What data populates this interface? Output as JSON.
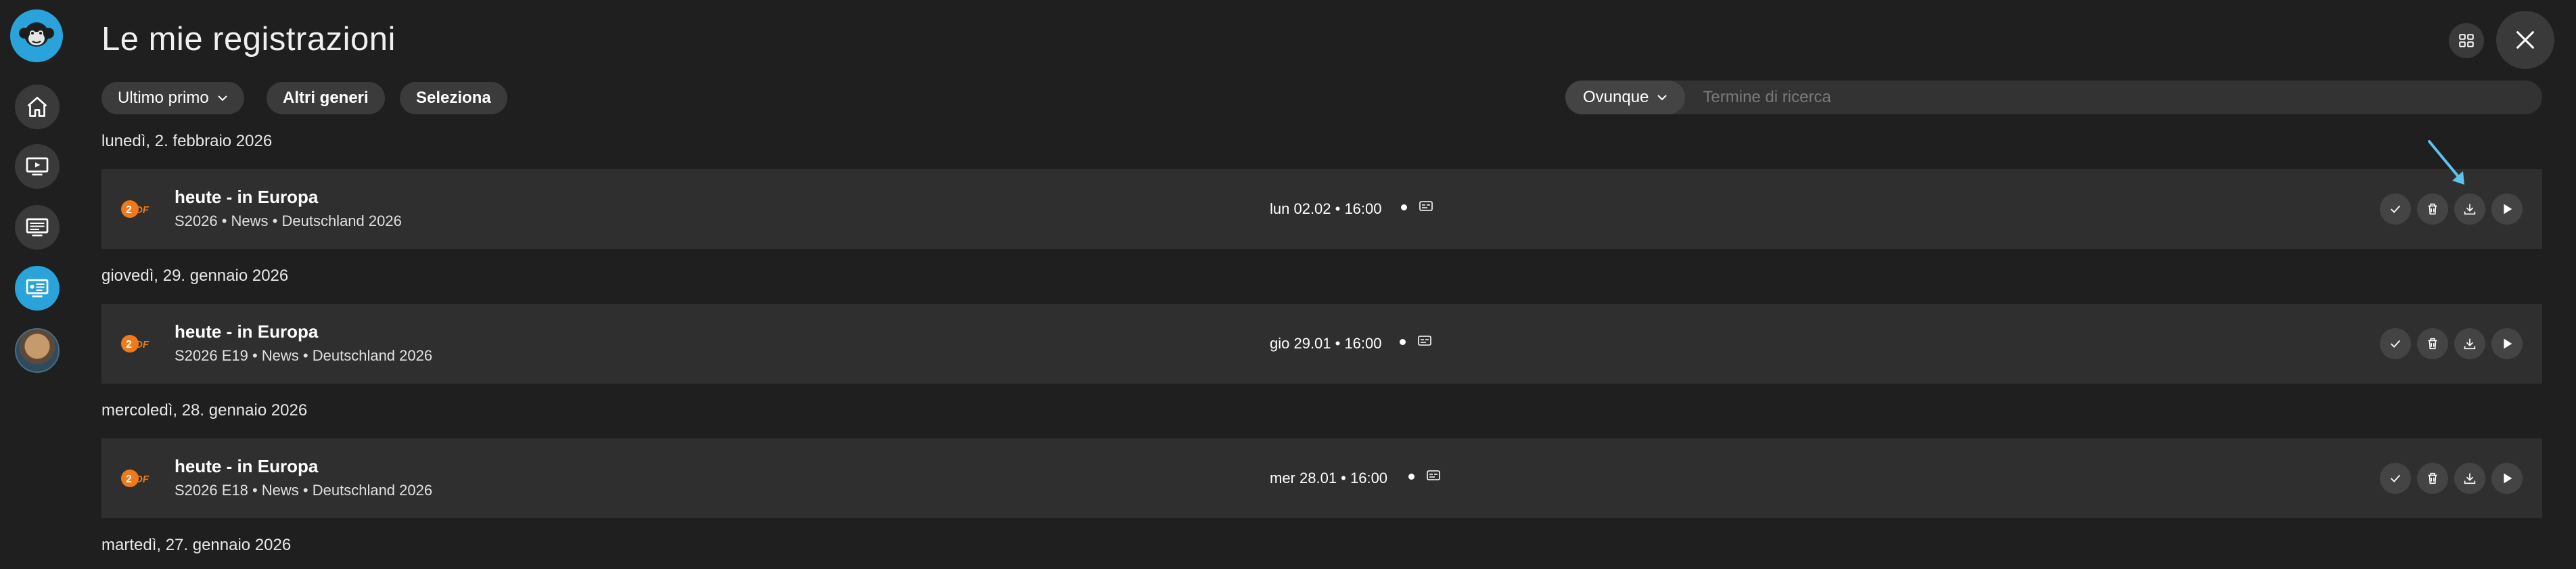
{
  "header": {
    "title": "Le mie registrazioni"
  },
  "filters": {
    "sort_label": "Ultimo primo",
    "genres_label": "Altri generi",
    "select_label": "Seleziona"
  },
  "search": {
    "scope_label": "Ovunque",
    "placeholder": "Termine di ricerca",
    "value": ""
  },
  "sidebar": {
    "items": [
      {
        "icon": "home-icon"
      },
      {
        "icon": "tv-play-icon"
      },
      {
        "icon": "epg-icon"
      },
      {
        "icon": "recordings-icon",
        "active": true
      },
      {
        "icon": "avatar"
      }
    ]
  },
  "recordings": [
    {
      "date_header": "lunedì, 2. febbraio 2026",
      "title": "heute - in Europa",
      "meta": "S2026 • News • Deutschland 2026",
      "time": "lun 02.02 • 16:00",
      "channel": "ZDF"
    },
    {
      "date_header": "giovedì, 29. gennaio 2026",
      "title": "heute - in Europa",
      "meta": "S2026 E19 • News • Deutschland 2026",
      "time": "gio 29.01 • 16:00",
      "channel": "ZDF"
    },
    {
      "date_header": "mercoledì, 28. gennaio 2026",
      "title": "heute - in Europa",
      "meta": "S2026 E18 • News • Deutschland 2026",
      "time": "mer 28.01 • 16:00",
      "channel": "ZDF"
    }
  ],
  "next_date_header": "martedì, 27. gennaio 2026",
  "colors": {
    "background": "#1f1f1f",
    "row": "#2f2f2f",
    "accent": "#2aa3da",
    "zdf_orange": "#f07a1a"
  }
}
